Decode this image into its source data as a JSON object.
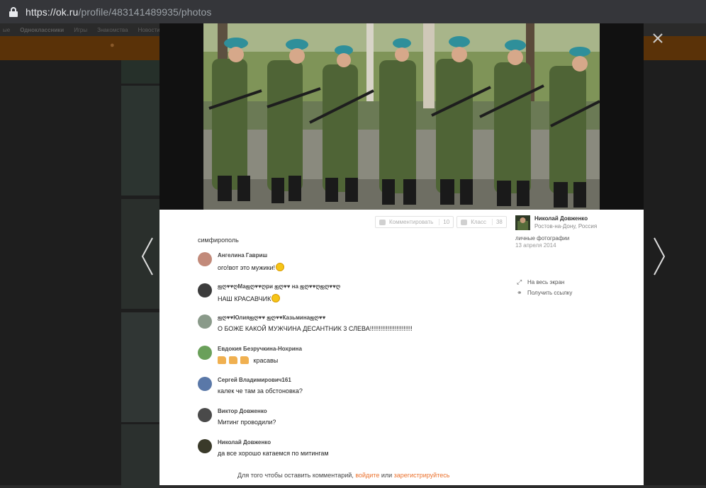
{
  "browser": {
    "url_host": "https://ok.ru",
    "url_path": "/profile/483141489935/photos"
  },
  "background": {
    "nav_items": [
      "ые",
      "Одноклассники",
      "Игры",
      "Знакомства",
      "Новости"
    ]
  },
  "post": {
    "caption": "симфирополь",
    "comment_btn": "Комментировать",
    "comment_count": "10",
    "like_btn": "Класс",
    "like_count": "38"
  },
  "owner": {
    "name": "Николай Довженко",
    "location": "Ростов-на-Дону, Россия",
    "album": "личные фотографии",
    "date": "13 апреля 2014",
    "fullscreen": "На весь экран",
    "get_link": "Получить ссылку"
  },
  "comments": [
    {
      "author": "Ангелина Гавриш",
      "text": "ого!вот это мужики!"
    },
    {
      "author": "ஐღ♥♥ღМаஐღ♥♥ღри ஐღ♥♥ на ஐღ♥♥ღஐღ♥♥ღ",
      "text": " НАШ КРАСАВЧИК"
    },
    {
      "author": "ஐღ♥♥Юлияஐღ♥♥ ஐღ♥♥Казьминаஐღ♥♥",
      "text": "О БОЖЕ КАКОЙ МУЖЧИНА ДЕСАНТНИК 3 СЛЕВА!!!!!!!!!!!!!!!!!!!!!!!!"
    },
    {
      "author": "Евдокия Безручкина-Нохрина",
      "text": "красавы"
    },
    {
      "author": "Сергей Владимирович161",
      "text": "калек че там за обстоновка?"
    },
    {
      "author": "Виктор Довженко",
      "text": "Митинг проводили?"
    },
    {
      "author": "Николай Довженко",
      "text": "да все хорошо катаемся по митингам"
    }
  ],
  "login_prompt": {
    "prefix": "Для того чтобы оставить комментарий, ",
    "login": "войдите",
    "or": " или ",
    "register": "зарегистрируйтесь"
  },
  "icons": [
    "lock-icon",
    "close-icon",
    "chevron-left-icon",
    "chevron-right-icon",
    "comment-icon",
    "like-icon",
    "fullscreen-icon",
    "link-icon"
  ],
  "colors": {
    "accent": "#eb722e",
    "overlay": "#1e1e1e"
  }
}
